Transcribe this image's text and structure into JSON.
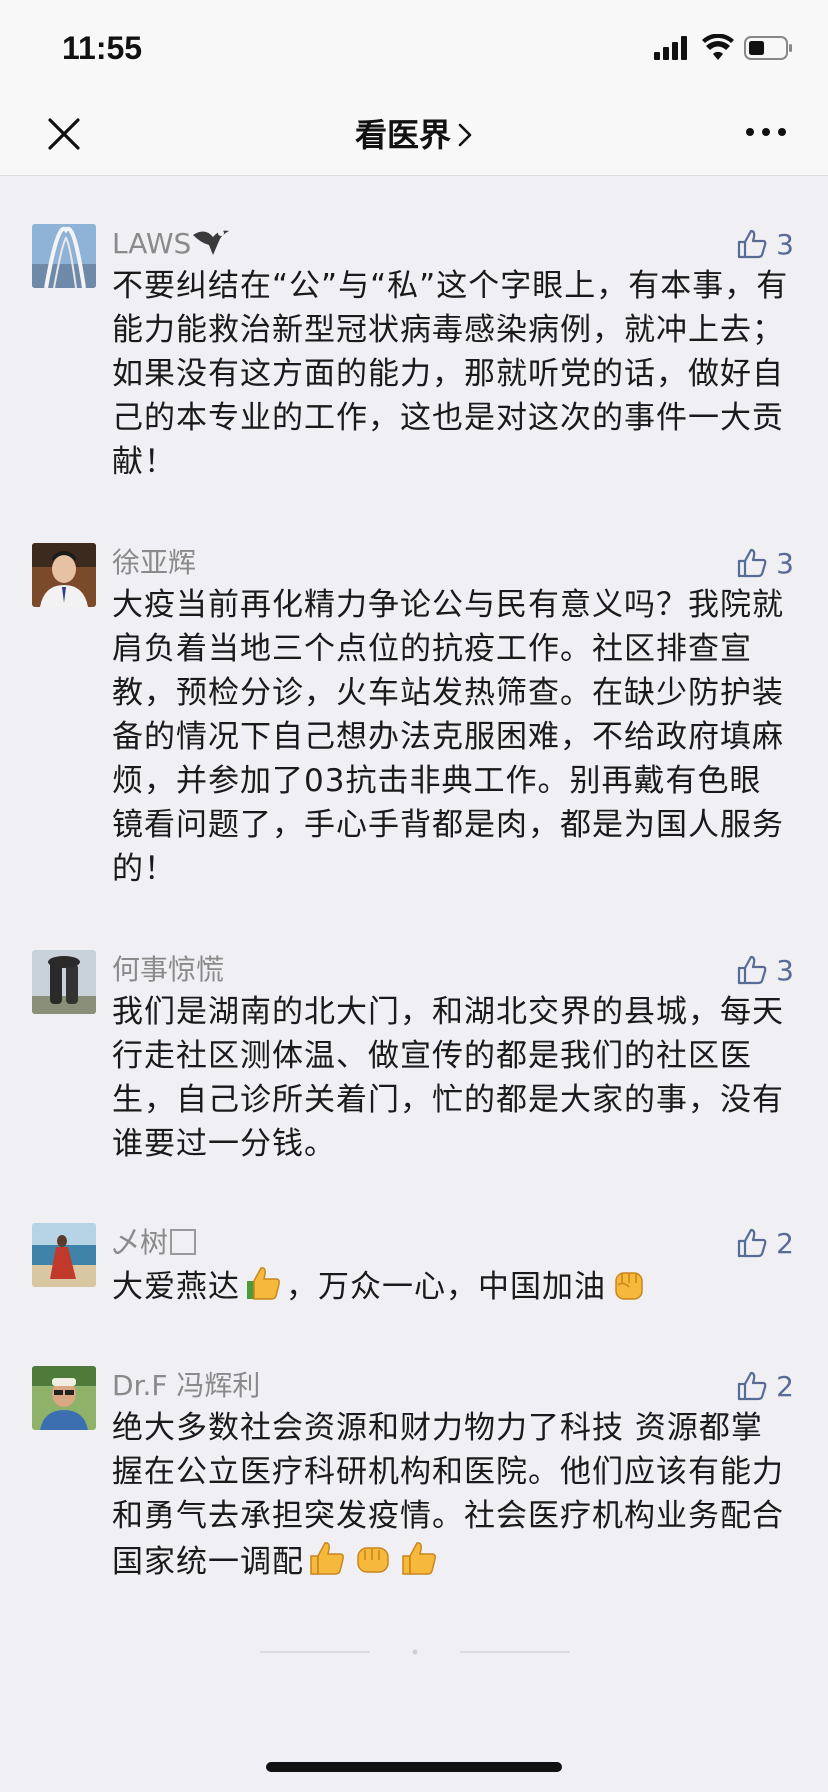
{
  "status_bar": {
    "time": "11:55"
  },
  "nav": {
    "title": "看医界"
  },
  "comments": [
    {
      "nickname": "LAWS",
      "likes": "3",
      "text": "不要纠结在“公”与“私”这个字眼上，有本事，有能力能救治新型冠状病毒感染病例，就冲上去；如果没有这方面的能力，那就听党的话，做好自己的本专业的工作，这也是对这次的事件一大贡献！"
    },
    {
      "nickname": "徐亚辉",
      "likes": "3",
      "text": "大疫当前再化精力争论公与民有意义吗？我院就肩负着当地三个点位的抗疫工作。社区排查宣教，预检分诊，火车站发热筛查。在缺少防护装备的情况下自己想办法克服困难，不给政府填麻烦，并参加了03抗击非典工作。别再戴有色眼镜看问题了，手心手背都是肉，都是为国人服务的！"
    },
    {
      "nickname": "何事惊慌",
      "likes": "3",
      "text": "我们是湖南的北大门，和湖北交界的县城，每天行走社区测体温、做宣传的都是我们的社区医生，自己诊所关着门，忙的都是大家的事，没有谁要过一分钱。"
    },
    {
      "nickname": "乄树",
      "likes": "2",
      "text_parts": [
        "大爱燕达",
        "，万众一心，中国加油"
      ]
    },
    {
      "nickname": "Dr.F 冯辉利",
      "likes": "2",
      "text": "绝大多数社会资源和财力物力了科技 资源都掌握在公立医疗科研机构和医院。他们应该有能力和勇气去承担突发疫情。社会医疗机构业务配合国家统一调配"
    }
  ],
  "colors": {
    "link_blue": "#576b95",
    "nickname_gray": "#8a8a8a",
    "background": "#efeff4"
  },
  "icons": [
    "signal-icon",
    "wifi-icon",
    "battery-icon",
    "close-icon",
    "chevron-right-icon",
    "more-icon",
    "thumbs-up-icon"
  ]
}
